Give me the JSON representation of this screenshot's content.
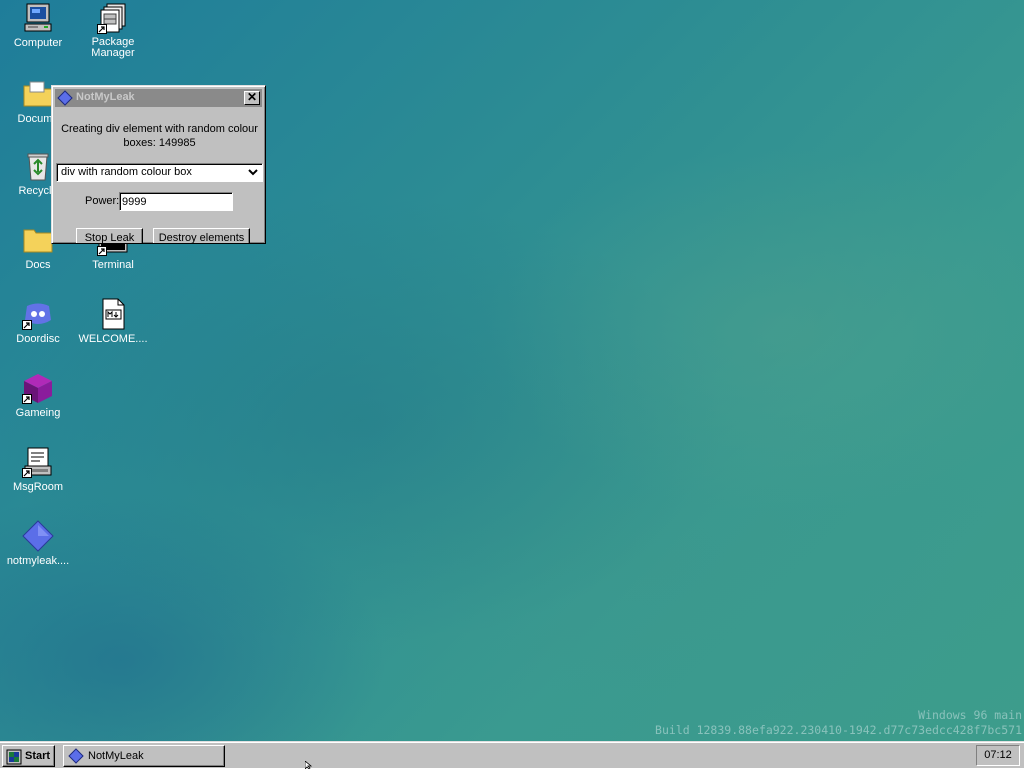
{
  "desktop": {
    "icons": [
      {
        "label": "Computer",
        "icon": "computer-icon"
      },
      {
        "label": "Package\nManager",
        "icon": "package-manager-icon"
      },
      {
        "label": "Docume",
        "icon": "documents-folder-icon"
      },
      {
        "label": "Recycle",
        "icon": "recycle-bin-icon"
      },
      {
        "label": "Docs",
        "icon": "folder-icon"
      },
      {
        "label": "Terminal",
        "icon": "terminal-icon"
      },
      {
        "label": "Doordisc",
        "icon": "doordisc-icon"
      },
      {
        "label": "WELCOME....",
        "icon": "markdown-file-icon"
      },
      {
        "label": "Gameing",
        "icon": "gameing-cube-icon"
      },
      {
        "label": "MsgRoom",
        "icon": "msgroom-icon"
      },
      {
        "label": "notmyleak....",
        "icon": "notmyleak-diamond-icon"
      }
    ],
    "watermark": {
      "line1": "Windows 96 main",
      "line2": "Build 12839.88efa922.230410-1942.d77c73edcc428f7bc571"
    }
  },
  "window": {
    "title": "NotMyLeak",
    "close_label": "✕",
    "message": "Creating div element with random colour boxes: 149985",
    "select_value": "div with random colour box",
    "power_label": "Power:",
    "power_value": "9999",
    "stop_label": "Stop Leak",
    "destroy_label": "Destroy elements"
  },
  "taskbar": {
    "start_label": "Start",
    "task_label": "NotMyLeak",
    "clock": "07:12"
  },
  "colors": {
    "accent_diamond": "#5b6ee8",
    "title_inactive": "#8a8a8a"
  }
}
